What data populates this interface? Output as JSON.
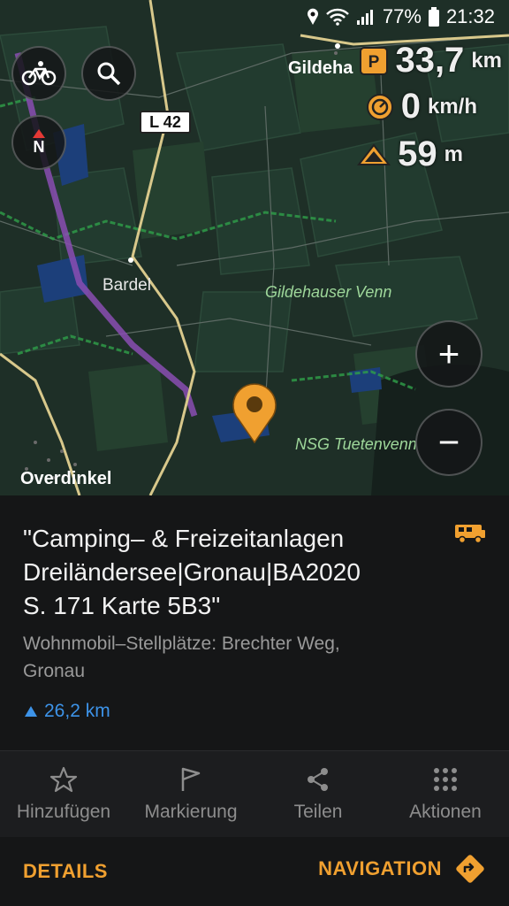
{
  "status_bar": {
    "battery": "77%",
    "time": "21:32",
    "icons": [
      "location-icon",
      "wifi-icon",
      "signal-icon",
      "battery-icon"
    ]
  },
  "map": {
    "labels": {
      "gildehaus": "Gildeha",
      "bardel": "Bardel",
      "gildehauser_venn": "Gildehauser Venn",
      "nsg_tuetenvenn": "NSG Tuetenvenn",
      "overdinkel": "Overdinkel"
    },
    "road_badge": "L 42",
    "buttons": {
      "profile": "bicycle-icon",
      "search": "search-icon",
      "compass": "N",
      "zoom_in": "+",
      "zoom_out": "−"
    },
    "hud": {
      "distance_value": "33,7",
      "distance_unit": "km",
      "speed_value": "0",
      "speed_unit": "km/h",
      "altitude_value": "59",
      "altitude_unit": "m"
    }
  },
  "poi": {
    "title_line1": "\"Camping– & Freizeitanlagen",
    "title_line2": "Dreiländersee|Gronau|BA2020",
    "title_line3": "S. 171 Karte 5B3\"",
    "subtitle_line1": "Wohnmobil–Stellplätze: Brechter Weg,",
    "subtitle_line2": "Gronau",
    "distance": "26,2 km"
  },
  "actions": [
    {
      "label": "Hinzufügen",
      "icon": "star-icon"
    },
    {
      "label": "Markierung",
      "icon": "flag-icon"
    },
    {
      "label": "Teilen",
      "icon": "share-icon"
    },
    {
      "label": "Aktionen",
      "icon": "dots-grid-icon"
    }
  ],
  "bottom_bar": {
    "details": "DETAILS",
    "navigation": "NAVIGATION"
  },
  "colors": {
    "accent": "#f0a030",
    "distance_blue": "#3d93e8",
    "map_bg": "#1e2f27"
  }
}
